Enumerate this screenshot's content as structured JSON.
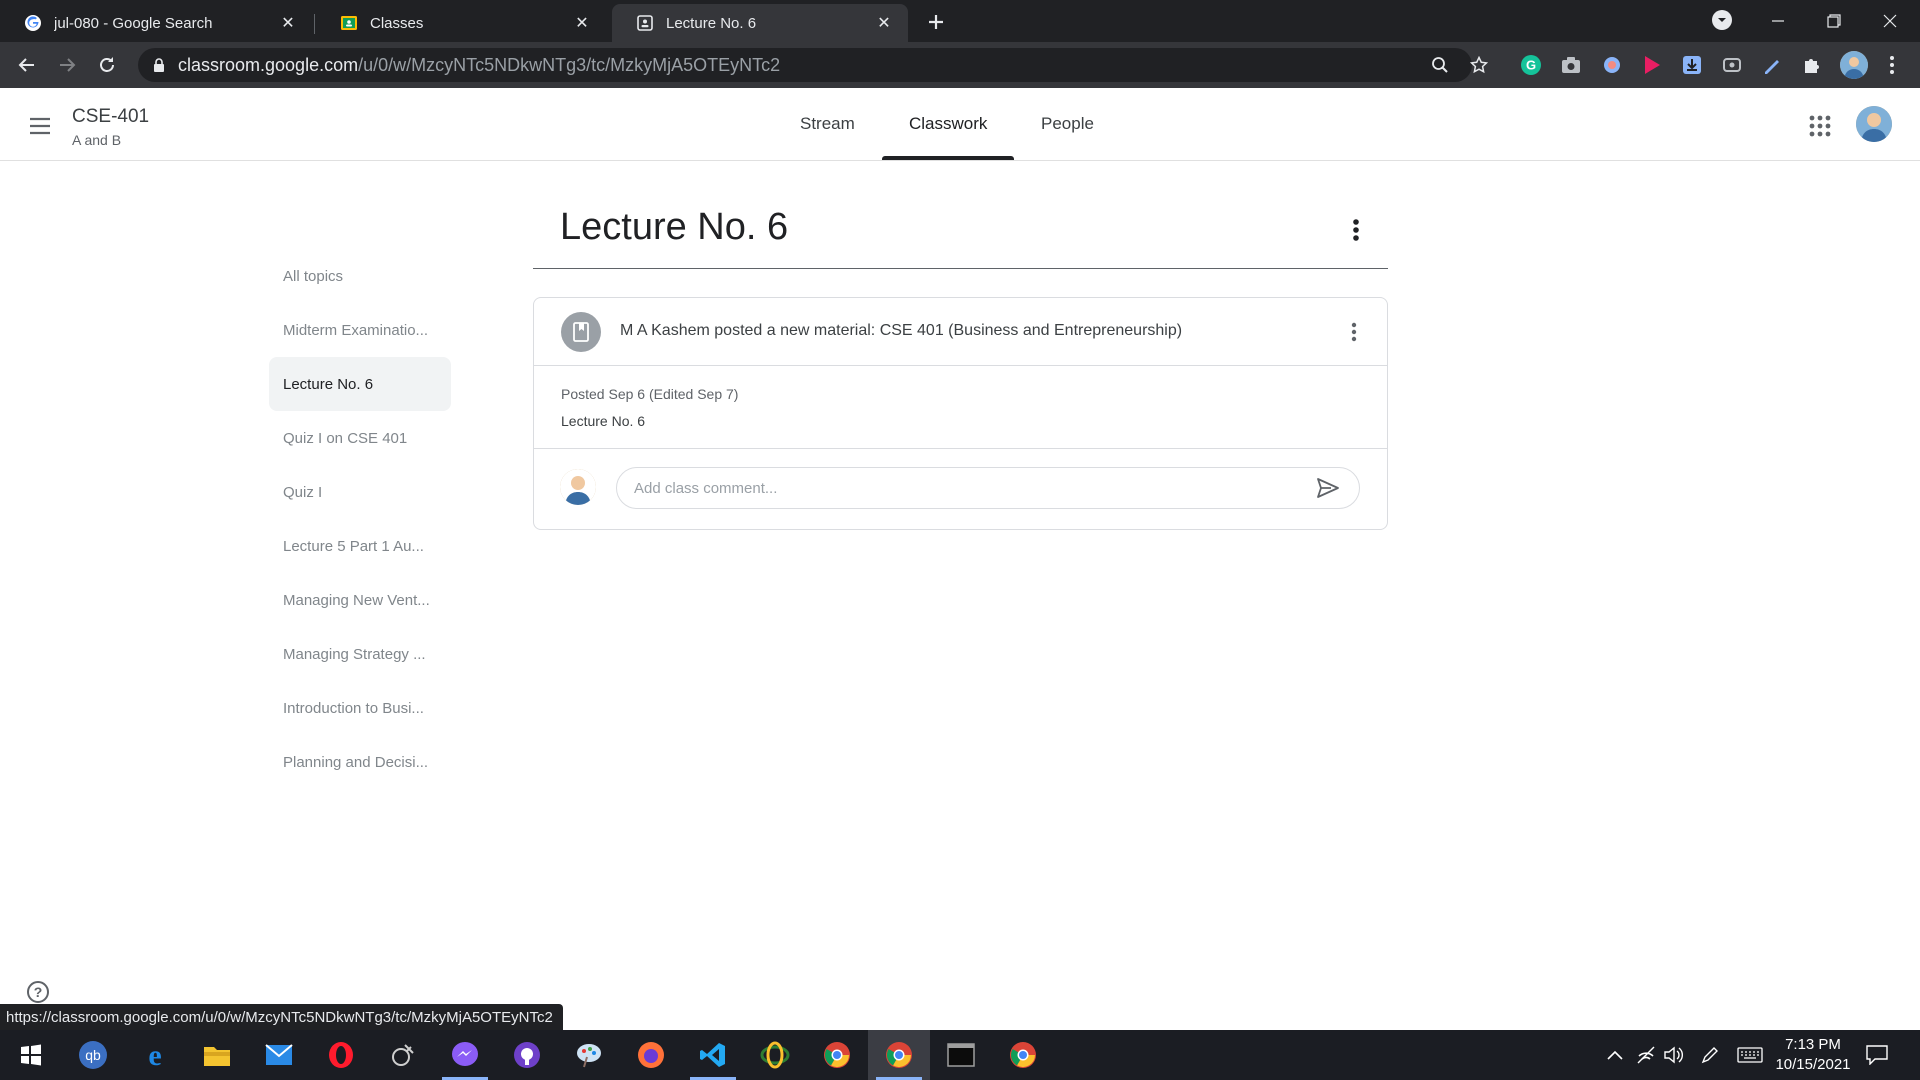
{
  "browser": {
    "tabs": [
      {
        "title": "jul-080 - Google Search",
        "favicon": "google-g-icon"
      },
      {
        "title": "Classes",
        "favicon": "classroom-icon"
      },
      {
        "title": "Lecture No. 6",
        "favicon": "classroom-page-icon"
      }
    ],
    "address": {
      "host": "classroom.google.com",
      "path": "/u/0/w/MzcyNTc5NDkwNTg3/tc/MzkyMjA5OTEyNTc2"
    },
    "status_url": "https://classroom.google.com/u/0/w/MzcyNTc5NDkwNTg3/tc/MzkyMjA5OTEyNTc2"
  },
  "classroom": {
    "class_name": "CSE-401",
    "class_section": "A and B",
    "nav_tabs": [
      {
        "label": "Stream"
      },
      {
        "label": "Classwork"
      },
      {
        "label": "People"
      }
    ],
    "active_tab": "Classwork"
  },
  "topics": [
    {
      "label": "All topics"
    },
    {
      "label": "Midterm Examinatio..."
    },
    {
      "label": "Lecture No. 6"
    },
    {
      "label": "Quiz I on CSE 401"
    },
    {
      "label": "Quiz I"
    },
    {
      "label": "Lecture 5 Part 1 Au..."
    },
    {
      "label": "Managing New Vent..."
    },
    {
      "label": "Managing Strategy ..."
    },
    {
      "label": "Introduction to Busi..."
    },
    {
      "label": "Planning and Decisi..."
    }
  ],
  "active_topic": "Lecture No. 6",
  "main": {
    "topic_title": "Lecture No. 6",
    "card": {
      "title": "M A Kashem posted a new material: CSE 401 (Business and Entrepreneurship)",
      "posted": "Posted Sep 6 (Edited Sep 7)",
      "description": "Lecture No. 6",
      "comment_placeholder": "Add class comment..."
    }
  },
  "taskbar": {
    "time": "7:13 PM",
    "date": "10/15/2021",
    "active_app": "chrome"
  },
  "colors": {
    "accent_underline": "#202124",
    "browser_dark": "#202124",
    "browser_toolbar": "#35363a",
    "taskbar": "#1b1d23"
  }
}
